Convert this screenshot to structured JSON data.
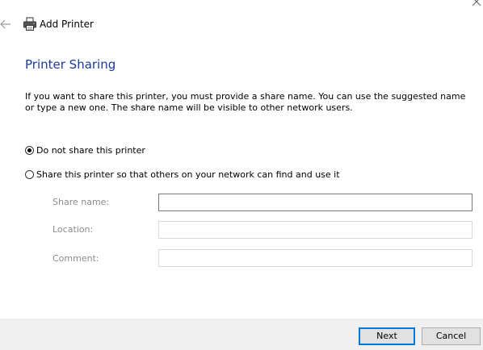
{
  "window": {
    "title": "Add Printer",
    "title_icon": "printer-icon",
    "back_icon": "back-arrow-icon",
    "close_icon": "close-icon"
  },
  "main": {
    "heading": "Printer Sharing",
    "description": "If you want to share this printer, you must provide a share name. You can use the suggested name or type a new one. The share name will be visible to other network users.",
    "options": [
      {
        "label": "Do not share this printer",
        "selected": true
      },
      {
        "label": "Share this printer so that others on your network can find and use it",
        "selected": false
      }
    ],
    "fields": {
      "share_name": {
        "label": "Share name:",
        "value": ""
      },
      "location": {
        "label": "Location:",
        "value": ""
      },
      "comment": {
        "label": "Comment:",
        "value": ""
      }
    }
  },
  "footer": {
    "next_label": "Next",
    "cancel_label": "Cancel"
  },
  "colors": {
    "heading": "#1a3a9c",
    "accent": "#0078d7",
    "footer_bg": "#f0f0f0",
    "disabled_label": "#8c8c8c"
  }
}
